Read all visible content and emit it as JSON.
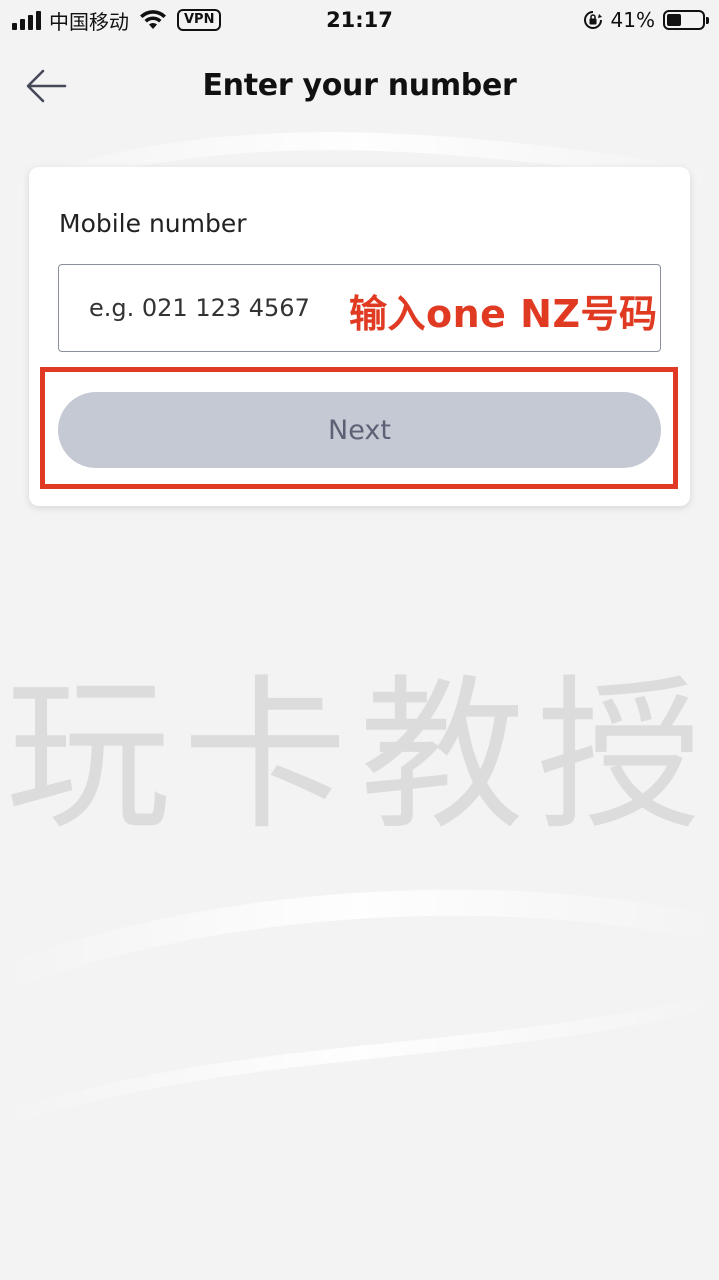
{
  "status_bar": {
    "carrier": "中国移动",
    "vpn": "VPN",
    "time": "21:17",
    "battery_percent": "41%",
    "battery_level": 0.41,
    "icons": [
      "signal-icon",
      "wifi-icon",
      "rotation-lock-icon",
      "battery-icon"
    ]
  },
  "header": {
    "title": "Enter your number",
    "back_icon": "arrow-left-icon"
  },
  "form": {
    "label": "Mobile number",
    "input_value": "",
    "input_placeholder": "e.g. 021 123 4567",
    "next_label": "Next"
  },
  "annotation": {
    "text": "输入one NZ号码",
    "color": "#e03a22"
  },
  "watermark": {
    "text": "玩卡教授"
  },
  "colors": {
    "button_disabled": "#c5c9d4",
    "button_text": "#5c6275",
    "highlight": "#e13a24"
  }
}
